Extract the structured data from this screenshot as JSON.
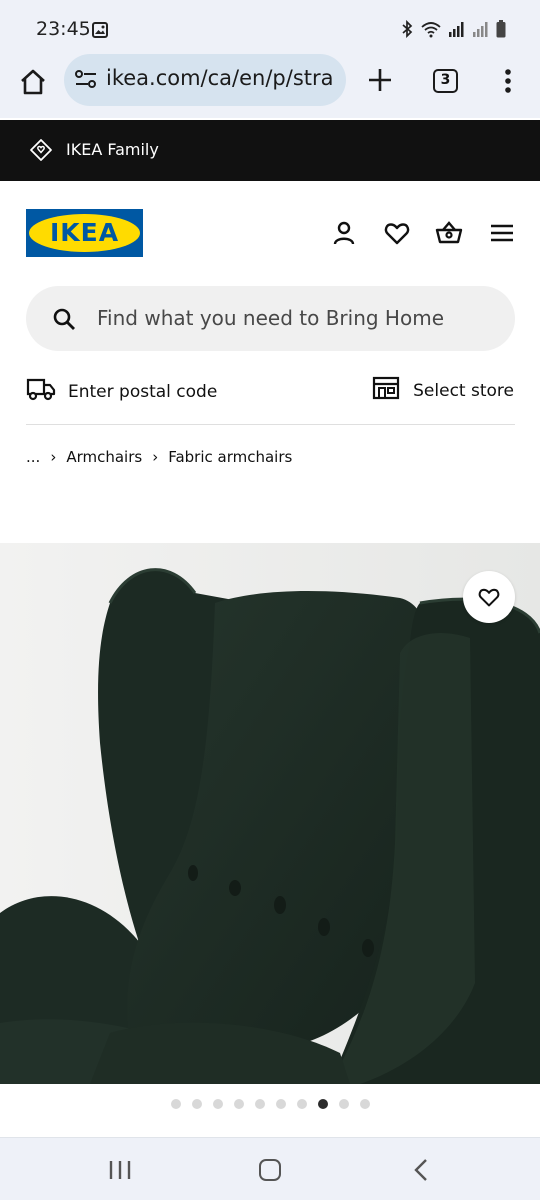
{
  "status_bar": {
    "time": "23:45"
  },
  "browser": {
    "url": "ikea.com/ca/en/p/stra",
    "tab_count": "3"
  },
  "family_bar": {
    "label": "IKEA Family"
  },
  "header": {
    "logo_text": "IKEA"
  },
  "search": {
    "placeholder": "Find what you need to Bring Home"
  },
  "delivery": {
    "postal_label": "Enter postal code",
    "store_label": "Select store"
  },
  "breadcrumb": {
    "ellipsis": "...",
    "items": [
      "Armchairs",
      "Fabric armchairs"
    ]
  },
  "carousel": {
    "total": 10,
    "active": 8
  },
  "colors": {
    "brand_blue": "#0058a3",
    "brand_yellow": "#ffdb00",
    "chair_green": "#1f2c25"
  }
}
